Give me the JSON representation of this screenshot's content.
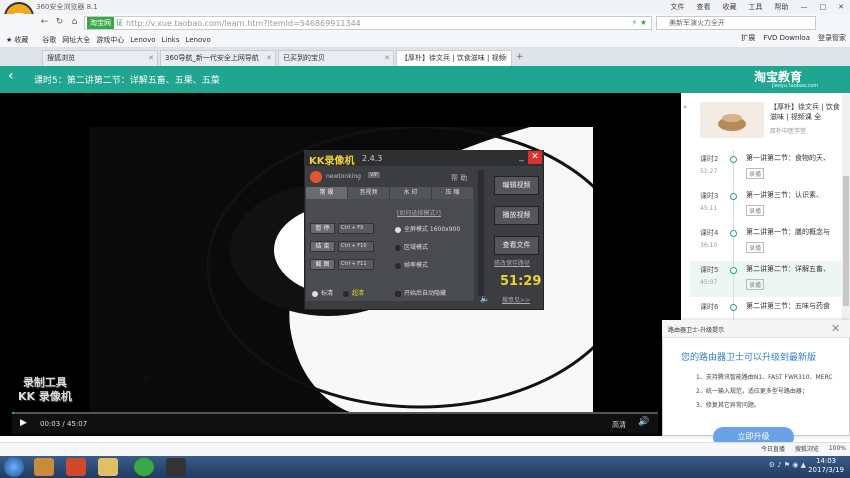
{
  "browser": {
    "title": "360安全浏览器 8.1",
    "menu": [
      "文件",
      "查看",
      "收藏",
      "工具",
      "帮助"
    ],
    "url_badge": "淘宝网",
    "url_cert": "证",
    "url": "http://v.xue.taobao.com/learn.htm?itemId=546869911344",
    "search_placeholder": "美新军演火力全开",
    "bookmarks": [
      "收藏",
      "谷歌",
      "网址大全",
      "游戏中心",
      "Lenovo",
      "Links",
      "Lenovo"
    ],
    "bookmarks_right": [
      "扩展",
      "FVD Downloa",
      "登录管家"
    ],
    "tabs": [
      {
        "label": "搜狐浏览",
        "active": false
      },
      {
        "label": "360导航_新一代安全上网导航",
        "active": false
      },
      {
        "label": "已买到的宝贝",
        "active": false
      },
      {
        "label": "【厚朴】徐文兵 | 饮食滋味 | 视频",
        "active": true
      }
    ],
    "status": [
      "今日直播",
      "搜狐浏览",
      "100%"
    ]
  },
  "page": {
    "lesson_title": "课时5：第二讲第二节：详解五畜、五果、五菜",
    "brand": "淘宝教育",
    "brand_sub": "jiaoyu.taobao.com"
  },
  "player": {
    "time": "00:03 / 45:07",
    "quality": "高清",
    "watermark_line1": "录制工具",
    "watermark_line2": "KK 录像机",
    "progress": 0.001
  },
  "recorder": {
    "name": "KK录像机",
    "version": "2.4.3",
    "username": "newtonking",
    "vip": "VIP",
    "help": "帮 助",
    "tabs": [
      "常 规",
      "音视频",
      "水 印",
      "压 缩"
    ],
    "actions": [
      {
        "label": "暂 停",
        "key": "Ctrl + F9"
      },
      {
        "label": "结 束",
        "key": "Ctrl + F10"
      },
      {
        "label": "截 图",
        "key": "Ctrl + F11"
      }
    ],
    "mode_link": "[如何选择模式?]",
    "modes": [
      "全屏模式 1600x900",
      "区域模式",
      "帧率模式"
    ],
    "quality_std": "标清",
    "quality_hd": "超清",
    "auto_hide": "开始后自动隐藏",
    "buttons": [
      "编辑视频",
      "播放视频",
      "查看文件"
    ],
    "save_path": "修改保存路径",
    "timer": "51:29",
    "feedback": "搜意见>>"
  },
  "sidebar": {
    "course_title": "【厚朴】徐文兵 | 饮食滋味 | 视频课 全",
    "seller": "厚朴中医学堂",
    "lessons": [
      {
        "num": "课时2",
        "dur": "51:27",
        "title": "第一讲第二节：食物的天、",
        "tag": "录播",
        "active": false
      },
      {
        "num": "课时3",
        "dur": "45:11",
        "title": "第一讲第三节：认识素、",
        "tag": "录播",
        "active": false
      },
      {
        "num": "课时4",
        "dur": "36:10",
        "title": "第二讲第一节：膳的概念与",
        "tag": "录播",
        "active": false
      },
      {
        "num": "课时5",
        "dur": "45:07",
        "title": "第二讲第二节：详解五畜、",
        "tag": "录播",
        "active": true
      },
      {
        "num": "课时6",
        "dur": "",
        "title": "第二讲第三节：五味与药食",
        "tag": "",
        "active": false
      }
    ]
  },
  "popup": {
    "title": "路由器卫士-升级提示",
    "main": "您的路由器卫士可以升级到最新版",
    "lines": [
      "1、支持腾讯智能路由N1、FAST FWR310、MERC",
      "2、统一输入规范，适应更多型号路由器；",
      "3、修复其它异常问题。"
    ],
    "button": "立即升级"
  },
  "taskbar": {
    "time": "14:03",
    "date": "2017/3/19"
  }
}
